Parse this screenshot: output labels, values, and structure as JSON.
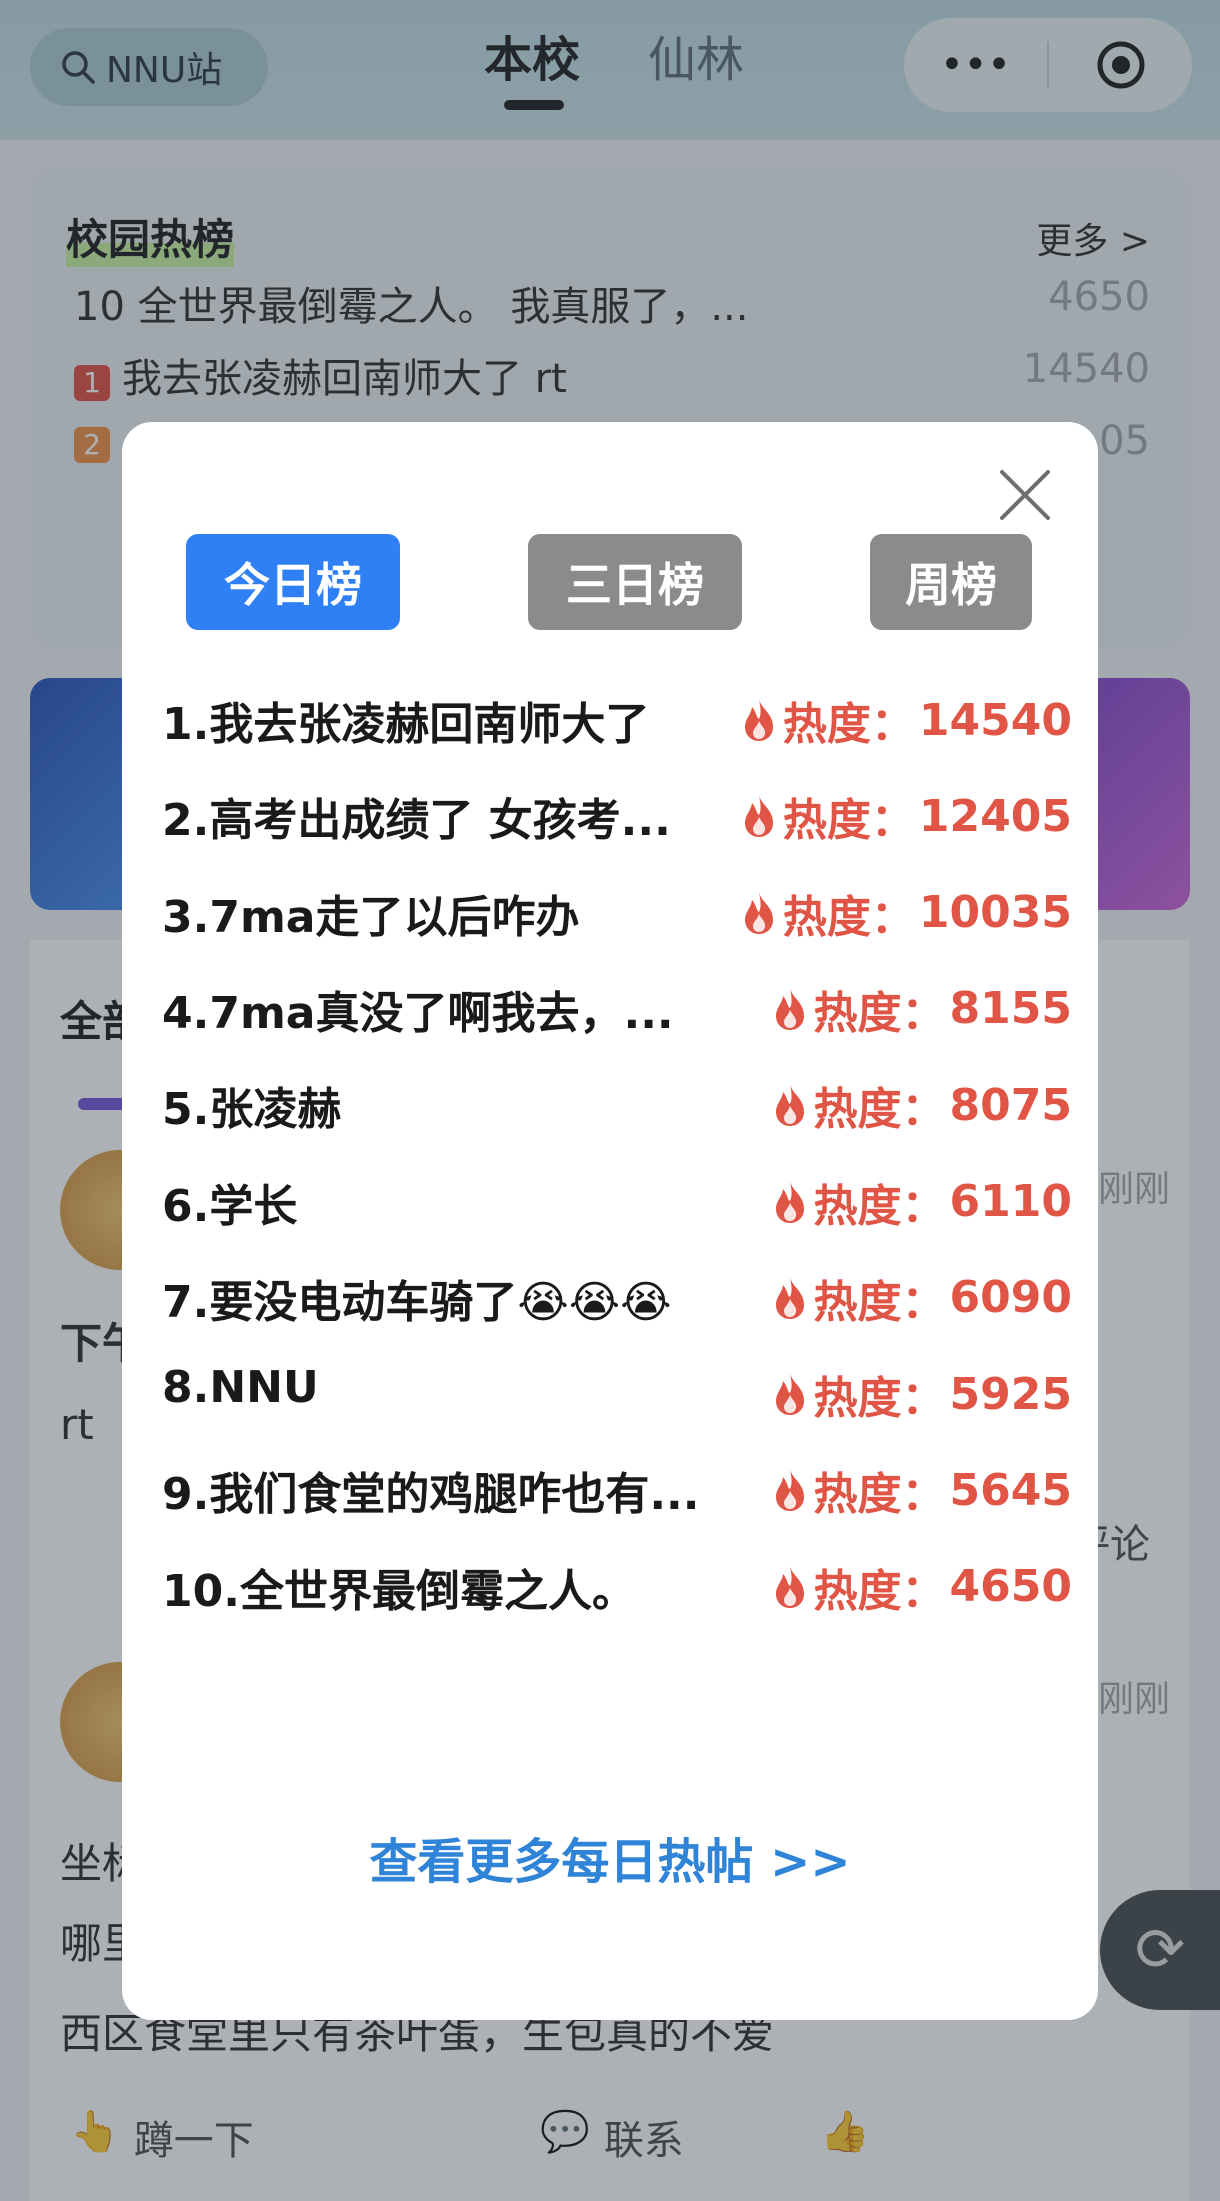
{
  "topbar": {
    "search_label": "NNU站",
    "tabs": [
      "本校",
      "仙林"
    ],
    "capsule_more": "•••"
  },
  "hot_card": {
    "title": "校园热榜",
    "more": "更多 >",
    "rows": [
      {
        "text": "10 全世界最倒霉之人。 我真服了，...",
        "value": "4650"
      },
      {
        "rank": "1",
        "text": "我去张凌赫回南师大了 rt",
        "value": "14540"
      },
      {
        "rank": "2",
        "text": "",
        "value": "05"
      }
    ]
  },
  "feed": {
    "tab_label": "全部",
    "post1": {
      "time": "刚刚",
      "title_fragment": "下午",
      "body": "rt",
      "action_right": "评论"
    },
    "post2": {
      "time": "刚刚",
      "lines": [
        "坐标",
        "哪里",
        "西区食堂里只有茶叶蛋，生包真的不爱"
      ]
    },
    "actions": [
      "蹲一下",
      "联系"
    ]
  },
  "modal": {
    "tabs": [
      {
        "label": "今日榜",
        "active": true
      },
      {
        "label": "三日榜",
        "active": false
      },
      {
        "label": "周榜",
        "active": false
      }
    ],
    "heat_label": "热度：",
    "items": [
      {
        "title": "1.我去张凌赫回南师大了",
        "heat": "14540"
      },
      {
        "title": "2.高考出成绩了 女孩考...",
        "heat": "12405"
      },
      {
        "title": "3.7ma走了以后咋办",
        "heat": "10035"
      },
      {
        "title": "4.7ma真没了啊我去，...",
        "heat": "8155"
      },
      {
        "title": "5.张凌赫",
        "heat": "8075"
      },
      {
        "title": "6.学长",
        "heat": "6110"
      },
      {
        "title": "7.要没电动车骑了😭😭😭",
        "heat": "6090"
      },
      {
        "title": "8.NNU",
        "heat": "5925"
      },
      {
        "title": "9.我们食堂的鸡腿咋也有...",
        "heat": "5645"
      },
      {
        "title": "10.全世界最倒霉之人。",
        "heat": "4650"
      }
    ],
    "more_link": "查看更多每日热帖 >>"
  },
  "colors": {
    "active_tab": "#2f7ff5",
    "inactive_tab": "#8b8b8b",
    "heat": "#e05545",
    "link": "#2f84d8"
  }
}
